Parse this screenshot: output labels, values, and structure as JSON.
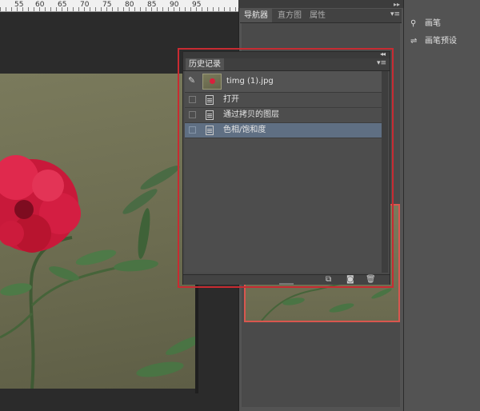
{
  "ruler": {
    "ticks": [
      "55",
      "60",
      "65",
      "70",
      "75",
      "80",
      "85",
      "90",
      "95"
    ]
  },
  "panel_tabs": {
    "navigator": "导航器",
    "histogram": "直方图",
    "info": "属性"
  },
  "brush_panel": {
    "brush_label": "画笔",
    "brush_preset_label": "画笔预设"
  },
  "history_panel": {
    "tab_label": "历史记录",
    "snapshot_name": "timg (1).jpg",
    "steps": [
      {
        "label": "打开",
        "selected": false
      },
      {
        "label": "通过拷贝的图层",
        "selected": false
      },
      {
        "label": "色相/饱和度",
        "selected": true
      }
    ],
    "footer_icons": [
      "new-document-from-state-icon",
      "camera-icon",
      "trash-icon"
    ]
  },
  "colors": {
    "highlight_outline": "#c82b32",
    "selected_row": "#5f6f83",
    "rose": "#d8203d"
  }
}
